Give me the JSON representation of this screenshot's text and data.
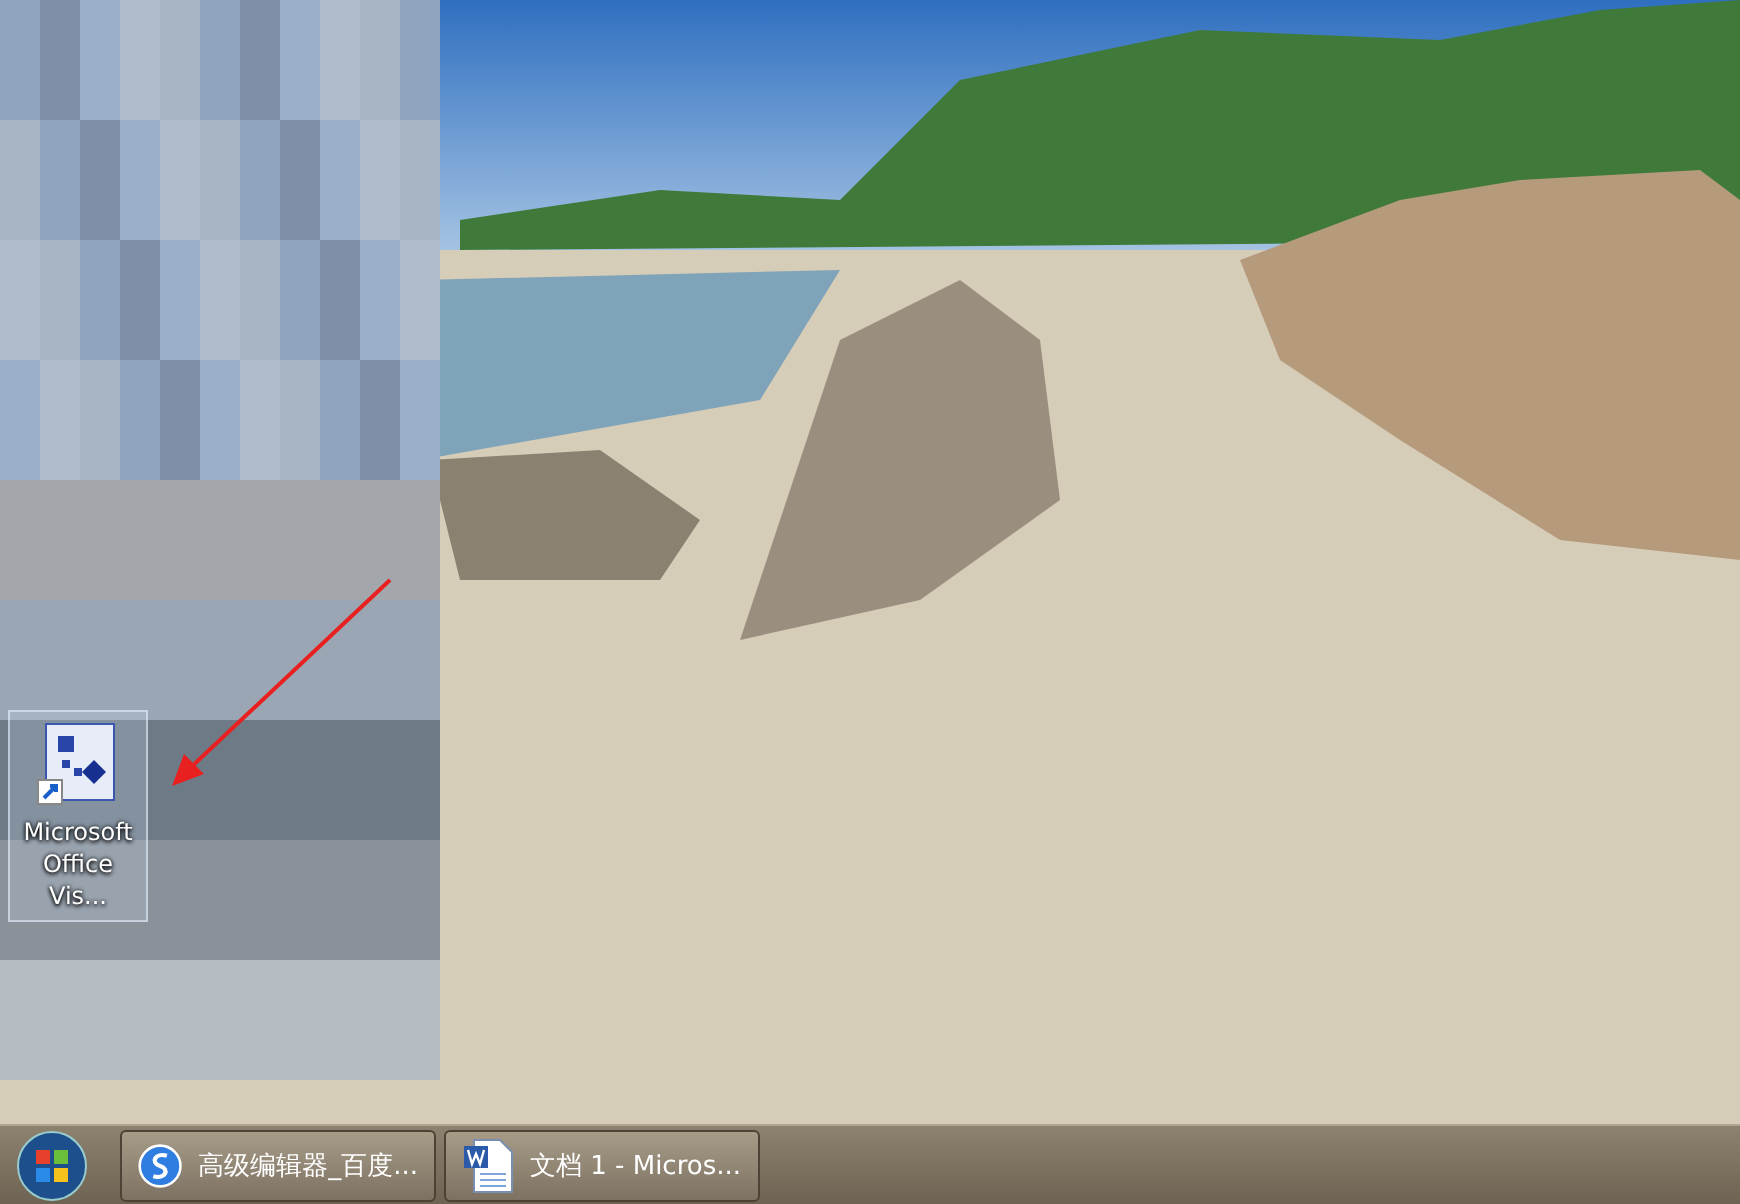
{
  "desktop": {
    "icons": [
      {
        "label": "Microsoft Office Vis...",
        "selected": true
      }
    ]
  },
  "taskbar": {
    "tasks": [
      {
        "label": "高级编辑器_百度...",
        "kind": "browser"
      },
      {
        "label": "文档 1 - Micros...",
        "kind": "document"
      }
    ]
  }
}
